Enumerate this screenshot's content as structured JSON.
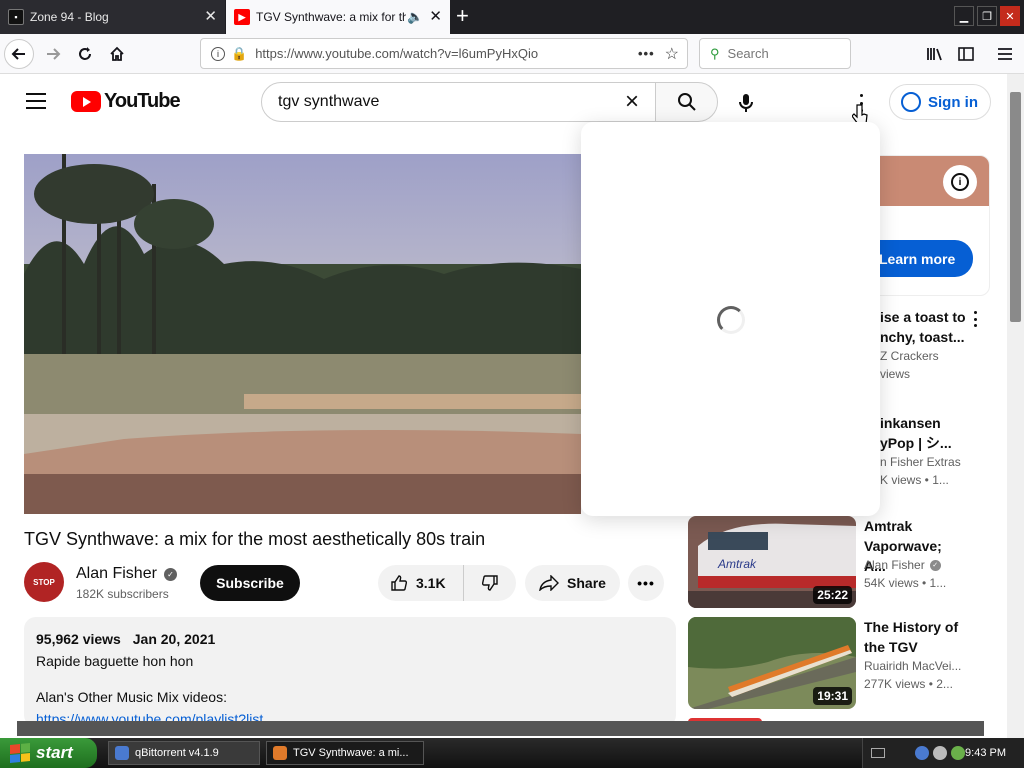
{
  "browser": {
    "tabs": [
      {
        "title": "Zone 94 - Blog",
        "icon": "zone94-favicon"
      },
      {
        "title": "TGV Synthwave: a mix for the",
        "icon": "youtube-favicon",
        "audio": "speaker-icon"
      }
    ],
    "new_tab_label": "+",
    "url": "https://www.youtube.com/watch?v=l6umPyHxQio",
    "search_placeholder": "Search",
    "url_menu": "•••"
  },
  "youtube": {
    "logo_text": "YouTube",
    "search_query": "tgv synthwave",
    "sign_in": "Sign in"
  },
  "video": {
    "title": "TGV Synthwave: a mix for the most aesthetically 80s train",
    "channel": "Alan Fisher",
    "subscribers": "182K subscribers",
    "subscribe_label": "Subscribe",
    "likes": "3.1K",
    "share_label": "Share",
    "more_label": "•••",
    "description": {
      "views": "95,962 views",
      "date": "Jan 20, 2021",
      "line1": "Rapide baguette hon hon",
      "line2": "Alan's Other Music Mix videos:",
      "link": "https://www.youtube.com/playlist?list"
    }
  },
  "ad": {
    "learn_more": "Learn more"
  },
  "recommendations_clipped": [
    {
      "title1": "ise a toast to",
      "title2": "nchy, toast...",
      "channel": "Z Crackers",
      "views": "views"
    },
    {
      "title1": "inkansen",
      "title2": "yPop | シ...",
      "channel": "n Fisher Extras",
      "views": "K views • 1..."
    }
  ],
  "recommendations": [
    {
      "title": "Amtrak Vaporwave; A...",
      "channel": "Alan Fisher",
      "views": "54K views • 1...",
      "duration": "25:22",
      "thumb_text": "Amtrak"
    },
    {
      "title": "The History of the TGV",
      "channel": "Ruairidh MacVei...",
      "views": "277K views • 2...",
      "duration": "19:31"
    }
  ],
  "taskbar": {
    "start": "start",
    "tasks": [
      {
        "label": "qBittorrent v4.1.9"
      },
      {
        "label": "TGV Synthwave: a mi..."
      }
    ],
    "clock": "9:43 PM"
  },
  "colors": {
    "youtube_red": "#ff0000",
    "link_blue": "#065fd4",
    "start_green": "#2e8b2e"
  }
}
